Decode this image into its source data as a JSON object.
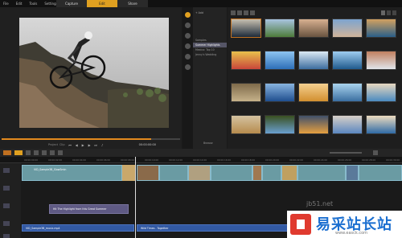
{
  "menu": [
    "File",
    "Edit",
    "Tools",
    "Settings"
  ],
  "steps": [
    "Capture",
    "Edit",
    "Share"
  ],
  "player": {
    "project_label": "Project",
    "clip_label": "Clip",
    "timecode": "00:00:00:00"
  },
  "library": {
    "folders": [
      "Samples",
      "Summer Highlights",
      "Mexico: Top 10",
      "Jenny's Wedding"
    ],
    "thumbs": [
      "",
      "",
      "",
      "",
      "",
      "",
      "",
      "",
      "",
      "",
      "",
      "",
      "",
      "",
      "",
      "",
      "",
      "",
      "",
      ""
    ],
    "browse": "Browse"
  },
  "timeline": {
    "ticks": [
      "00:00:00:00",
      "00:00:02:00",
      "00:00:04:00",
      "00:00:06:00",
      "00:00:08:00",
      "00:00:10:00",
      "00:00:12:00",
      "00:00:14:00",
      "00:00:16:00",
      "00:00:18:00",
      "00:00:20:00",
      "00:00:22:00",
      "00:00:24:00",
      "00:00:26:00",
      "00:00:28:00",
      "00:00:30:00"
    ],
    "video_clip_1": "VID_Sample3B_SlowSmin",
    "title_clip": "Hit The Highlight from this Great Summer",
    "audio_clip_1": "VID_Sample3B_music.mp4",
    "audio_clip_2": "Wild Times - Together"
  },
  "watermark": {
    "text": "易采站长站",
    "url": "www.easck.com",
    "sub": "jb51.net"
  }
}
